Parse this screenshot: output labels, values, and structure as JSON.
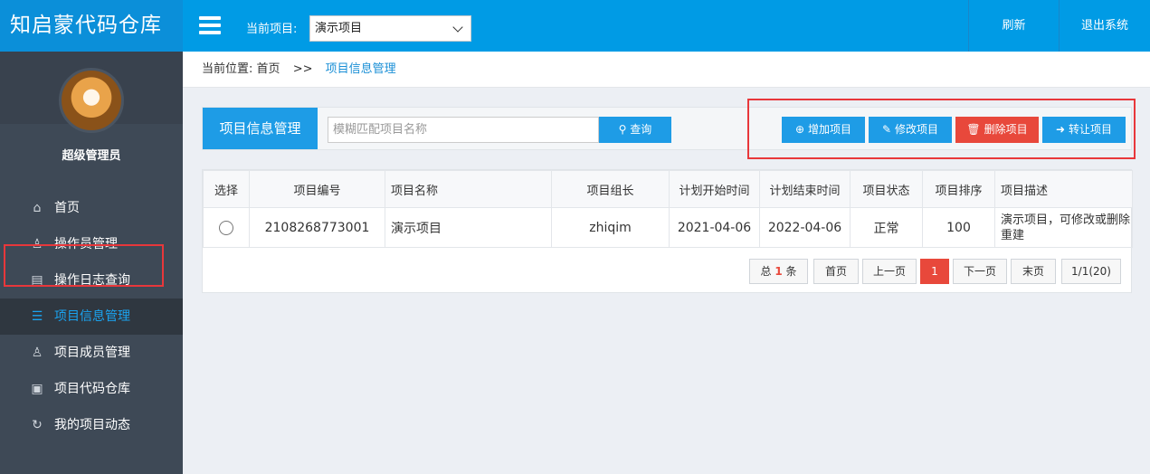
{
  "app": {
    "title": "知启蒙代码仓库"
  },
  "header": {
    "project_label": "当前项目:",
    "project_selected": "演示项目",
    "refresh_label": "刷新",
    "logout_label": "退出系统"
  },
  "sidebar": {
    "user_name": "超级管理员",
    "items": [
      {
        "label": "首页",
        "icon": "home-icon"
      },
      {
        "label": "操作员管理",
        "icon": "user-icon"
      },
      {
        "label": "操作日志查询",
        "icon": "document-icon"
      },
      {
        "label": "项目信息管理",
        "icon": "list-icon",
        "active": true
      },
      {
        "label": "项目成员管理",
        "icon": "user-icon"
      },
      {
        "label": "项目代码仓库",
        "icon": "briefcase-icon"
      },
      {
        "label": "我的项目动态",
        "icon": "refresh-icon"
      }
    ]
  },
  "breadcrumb": {
    "prefix": "当前位置:",
    "home": "首页",
    "separator": ">>",
    "current": "项目信息管理"
  },
  "toolbar": {
    "panel_title": "项目信息管理",
    "search_placeholder": "模糊匹配项目名称",
    "search_button": "查询",
    "add_label": "增加项目",
    "edit_label": "修改项目",
    "delete_label": "删除项目",
    "transfer_label": "转让项目"
  },
  "table": {
    "columns": [
      "选择",
      "项目编号",
      "项目名称",
      "项目组长",
      "计划开始时间",
      "计划结束时间",
      "项目状态",
      "项目排序",
      "项目描述"
    ],
    "rows": [
      {
        "id": "2108268773001",
        "name": "演示项目",
        "leader": "zhiqim",
        "start": "2021-04-06",
        "end": "2022-04-06",
        "status": "正常",
        "order": "100",
        "description": "演示项目，可修改或删除重建"
      }
    ]
  },
  "pagination": {
    "total_prefix": "总",
    "total_count": "1",
    "total_suffix": "条",
    "first": "首页",
    "prev": "上一页",
    "current_page": "1",
    "next": "下一页",
    "last": "末页",
    "page_info": "1/1(20)"
  },
  "colors": {
    "accent": "#009be5",
    "sidebar_bg": "#3e4956",
    "danger": "#e8483b",
    "highlight_outline": "#e8373b"
  }
}
